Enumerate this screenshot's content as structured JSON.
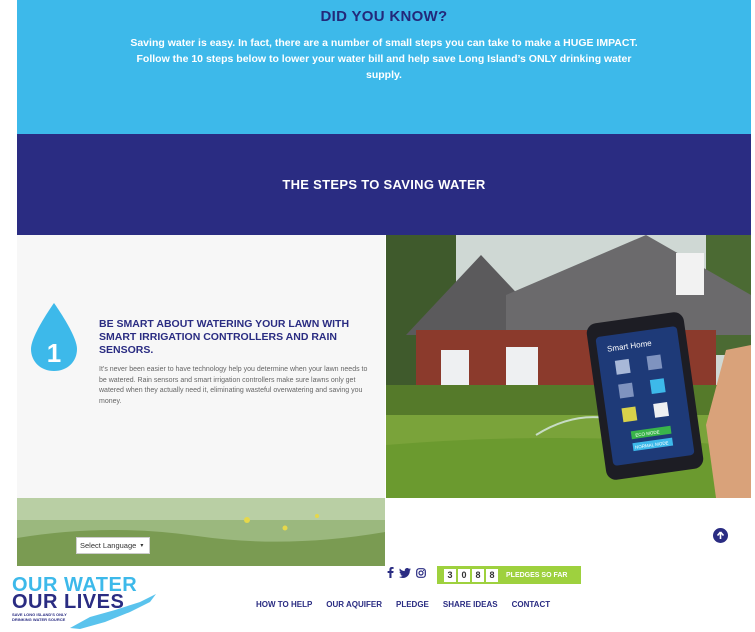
{
  "banner": {
    "title": "DID YOU KNOW?",
    "text": "Saving water is easy. In fact, there are a number of small steps you can take to make a HUGE IMPACT. Follow the 10 steps below to lower your water bill and help save Long Island’s ONLY drinking water supply."
  },
  "steps_header": "THE STEPS TO SAVING WATER",
  "step": {
    "number": "1",
    "title": "BE SMART ABOUT WATERING YOUR LAWN WITH SMART IRRIGATION CONTROLLERS AND RAIN SENSORS.",
    "body": "It’s never been easier to have technology help you determine when your lawn needs to be watered. Rain sensors and smart irrigation controllers make sure lawns only get watered when they actually need it, eliminating wasteful overwatering and saving you money."
  },
  "phone": {
    "title": "Smart Home",
    "eco_mode": "ECO MODE",
    "normal_mode": "NORMAL MODE"
  },
  "language": {
    "label": "Select Language",
    "caret": "▾"
  },
  "back_to_top_icon": "arrow-up-circle-icon",
  "logo": {
    "line1": "OUR WATER",
    "line2": "OUR LIVES",
    "tagline": "SAVE LONG ISLAND'S ONLY DRINKING WATER SOURCE"
  },
  "social": [
    "facebook-icon",
    "twitter-icon",
    "instagram-icon"
  ],
  "pledges": {
    "digits": [
      "3",
      "0",
      "8",
      "8"
    ],
    "label": "PLEDGES SO FAR"
  },
  "nav": [
    "HOW TO HELP",
    "OUR AQUIFER",
    "PLEDGE",
    "SHARE IDEAS",
    "CONTACT"
  ],
  "colors": {
    "sky": "#3db9ea",
    "navy": "#2a2c82",
    "green": "#9ed13e"
  }
}
